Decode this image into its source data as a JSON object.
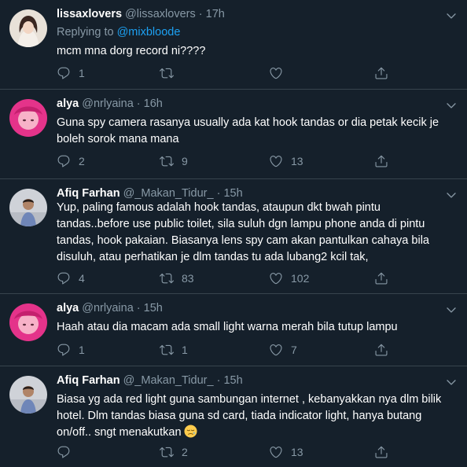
{
  "tweets": [
    {
      "name": "lissaxlovers",
      "handle": "@lissaxlovers",
      "dot": "·",
      "time": "17h",
      "replying_prefix": "Replying to ",
      "replying_to": "@mixbloode",
      "text": "mcm mna dorg record ni????",
      "replies": "1",
      "retweets": "",
      "likes": "",
      "avatar_color": "#d8cfc6"
    },
    {
      "name": "alya",
      "handle": "@nrlyaina",
      "dot": "·",
      "time": "16h",
      "text": "Guna spy camera rasanya usually ada kat hook tandas or dia petak kecik je boleh sorok mana mana",
      "replies": "2",
      "retweets": "9",
      "likes": "13",
      "avatar_color": "#e4338a"
    },
    {
      "name": "Afiq Farhan",
      "handle": "@_Makan_Tidur_",
      "dot": "·",
      "time": "15h",
      "text": "Yup, paling famous adalah hook tandas, ataupun dkt bwah pintu tandas..before use public toilet, sila suluh dgn lampu phone anda di pintu tandas, hook pakaian. Biasanya lens spy cam akan pantulkan cahaya bila disuluh, atau perhatikan je dlm tandas tu ada lubang2 kcil tak,",
      "replies": "4",
      "retweets": "83",
      "likes": "102",
      "avatar_color": "#c9cbd1"
    },
    {
      "name": "alya",
      "handle": "@nrlyaina",
      "dot": "·",
      "time": "15h",
      "text": "Haah atau dia macam ada small light warna merah bila tutup lampu",
      "replies": "1",
      "retweets": "1",
      "likes": "7",
      "avatar_color": "#e4338a"
    },
    {
      "name": "Afiq Farhan",
      "handle": "@_Makan_Tidur_",
      "dot": "·",
      "time": "15h",
      "text": "Biasa yg ada red light guna sambungan internet , kebanyakkan nya dlm bilik hotel. Dlm tandas biasa guna sd card, tiada indicator light, hanya butang on/off.. sngt menakutkan",
      "replies": "",
      "retweets": "2",
      "likes": "13",
      "avatar_color": "#c9cbd1"
    }
  ],
  "colors": {
    "background": "#15202b",
    "secondary_text": "#8899a6",
    "link": "#1da1f2",
    "divider": "#38444d"
  },
  "icons": [
    "reply-icon",
    "retweet-icon",
    "like-icon",
    "share-icon",
    "caret-down-icon",
    "sleepy-face-emoji"
  ]
}
